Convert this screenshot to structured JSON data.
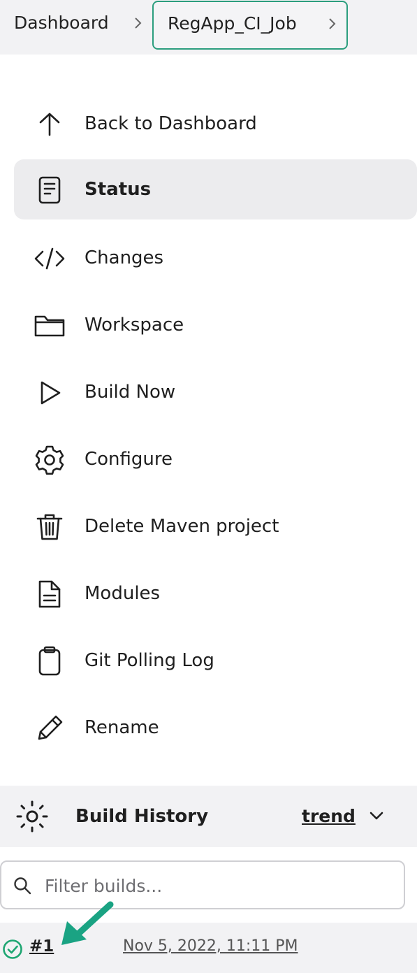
{
  "breadcrumb": {
    "items": [
      {
        "label": "Dashboard"
      },
      {
        "label": "RegApp_CI_Job"
      }
    ]
  },
  "sidebar": {
    "items": [
      {
        "label": "Back to Dashboard",
        "icon": "arrow-up-icon"
      },
      {
        "label": "Status",
        "icon": "document-icon",
        "active": true
      },
      {
        "label": "Changes",
        "icon": "code-icon"
      },
      {
        "label": "Workspace",
        "icon": "folder-icon"
      },
      {
        "label": "Build Now",
        "icon": "play-icon"
      },
      {
        "label": "Configure",
        "icon": "gear-icon"
      },
      {
        "label": "Delete Maven project",
        "icon": "trash-icon"
      },
      {
        "label": "Modules",
        "icon": "file-icon"
      },
      {
        "label": "Git Polling Log",
        "icon": "clipboard-icon"
      },
      {
        "label": "Rename",
        "icon": "pencil-icon"
      }
    ]
  },
  "build_history": {
    "title": "Build History",
    "trend_label": "trend",
    "filter_placeholder": "Filter builds...",
    "builds": [
      {
        "number": "#1",
        "date": "Nov 5, 2022, 11:11 PM",
        "status": "success"
      }
    ]
  },
  "colors": {
    "accent": "#2c9e7e",
    "success": "#1ea672",
    "annotation_arrow": "#1aa383"
  }
}
